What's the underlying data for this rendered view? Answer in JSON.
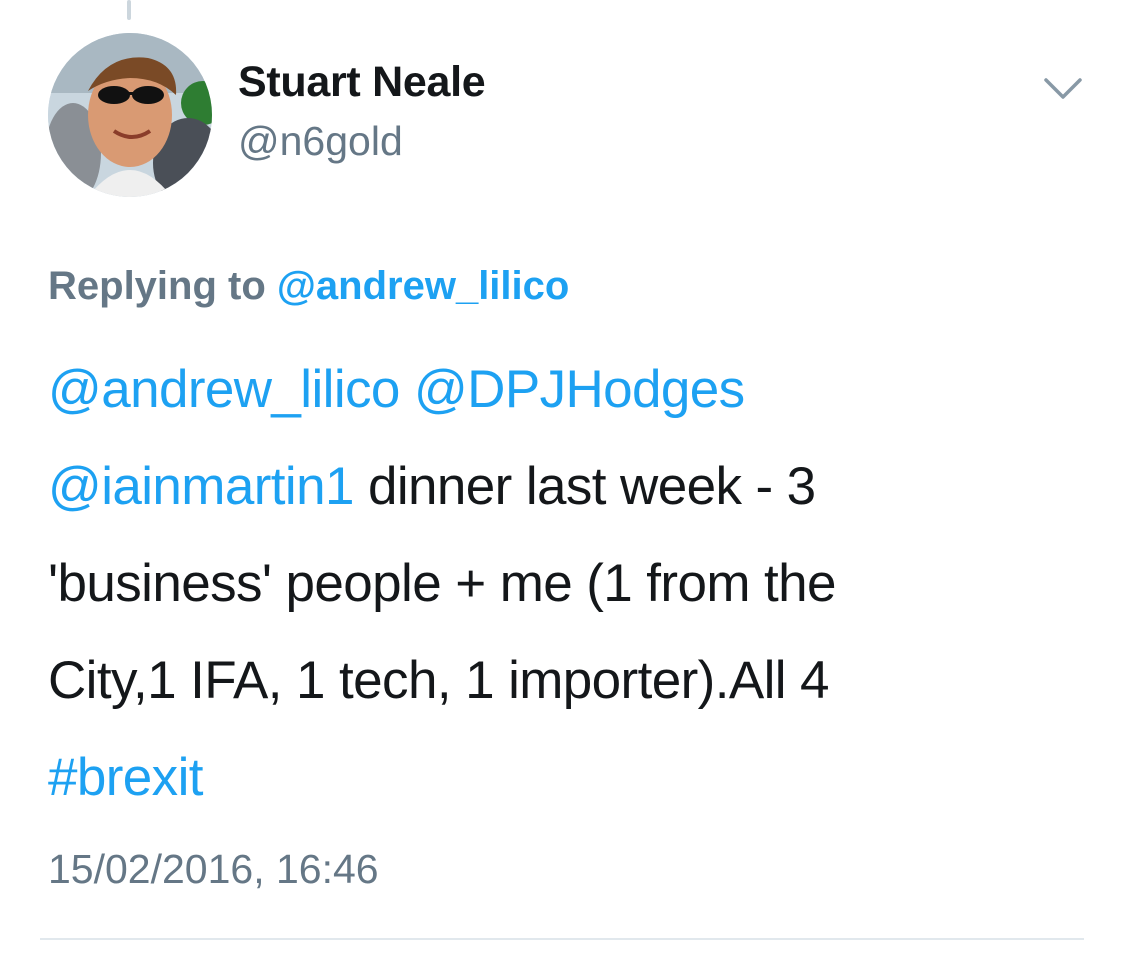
{
  "tweet": {
    "author": {
      "display_name": "Stuart Neale",
      "handle": "@n6gold"
    },
    "replying": {
      "label": "Replying to",
      "to": "@andrew_lilico"
    },
    "body_lines": [
      [
        {
          "t": "@andrew_lilico",
          "link": true
        },
        {
          "t": " ",
          "link": false
        },
        {
          "t": "@DPJHodges",
          "link": true
        }
      ],
      [
        {
          "t": "@iainmartin1",
          "link": true
        },
        {
          "t": " dinner last week - 3",
          "link": false
        }
      ],
      [
        {
          "t": "'business' people + me (1 from the",
          "link": false
        }
      ],
      [
        {
          "t": "City,1 IFA, 1 tech, 1 importer).All 4",
          "link": false
        }
      ],
      [
        {
          "t": "#brexit",
          "link": true
        }
      ]
    ],
    "timestamp": "15/02/2016, 16:46"
  },
  "icons": {
    "caret": "chevron-down-icon",
    "avatar": "profile-photo"
  },
  "colors": {
    "link": "#1da1f2",
    "text": "#14171a",
    "secondary": "#657786",
    "divider": "#e1e8ed"
  }
}
